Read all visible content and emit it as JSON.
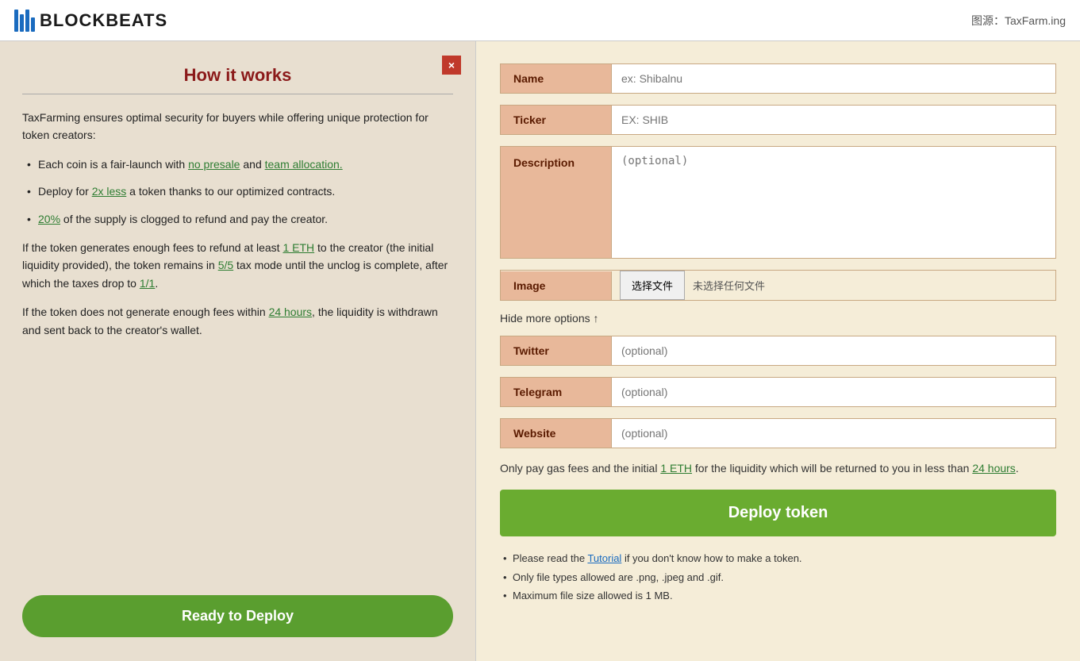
{
  "header": {
    "logo_text": "BLOCKBEATS",
    "source_text": "图源：TaxFarm.ing"
  },
  "left_panel": {
    "title": "How it works",
    "close_label": "×",
    "intro": "TaxFarming ensures optimal security for buyers while offering unique protection for token creators:",
    "bullets": [
      {
        "text_before": "Each coin is a fair-launch with ",
        "link1": "no presale",
        "text_middle": " and ",
        "link2": "team allocation.",
        "text_after": ""
      },
      {
        "text_before": "Deploy for ",
        "link1": "2x less",
        "text_after": " a token thanks to our optimized contracts."
      },
      {
        "text_before": "",
        "link1": "20%",
        "text_after": " of the supply is clogged to refund and pay the creator."
      }
    ],
    "para1_before": "If the token generates enough fees to refund at least ",
    "para1_link": "1 ETH",
    "para1_after": " to the creator (the initial liquidity provided), the token remains in ",
    "para1_link2": "5/5",
    "para1_middle": " tax mode until the unclog is complete, after which the taxes drop to ",
    "para1_link3": "1/1",
    "para1_end": ".",
    "para2_before": "If the token does not generate enough fees within ",
    "para2_link": "24 hours",
    "para2_after": ", the liquidity is withdrawn and sent back to the creator's wallet.",
    "ready_button": "Ready to Deploy"
  },
  "right_panel": {
    "form": {
      "name_label": "Name",
      "name_placeholder": "ex: Shibalnu",
      "ticker_label": "Ticker",
      "ticker_placeholder": "EX: SHIB",
      "description_label": "Description",
      "description_placeholder": "(optional)",
      "image_label": "Image",
      "image_choose_btn": "选择文件",
      "image_no_file": "未选择任何文件",
      "hide_options": "Hide more options ↑",
      "twitter_label": "Twitter",
      "twitter_placeholder": "(optional)",
      "telegram_label": "Telegram",
      "telegram_placeholder": "(optional)",
      "website_label": "Website",
      "website_placeholder": "(optional)"
    },
    "deploy_info_before": "Only pay gas fees and the initial ",
    "deploy_info_link": "1 ETH",
    "deploy_info_after": " for the liquidity which will be returned to you in less than ",
    "deploy_info_link2": "24 hours",
    "deploy_info_end": ".",
    "deploy_button": "Deploy token",
    "notes": [
      {
        "text_before": "Please read the ",
        "link": "Tutorial",
        "text_after": " if you don't know how to make a token."
      },
      {
        "text": "Only file types allowed are .png, .jpeg and .gif."
      },
      {
        "text": "Maximum file size allowed is 1 MB."
      }
    ]
  }
}
